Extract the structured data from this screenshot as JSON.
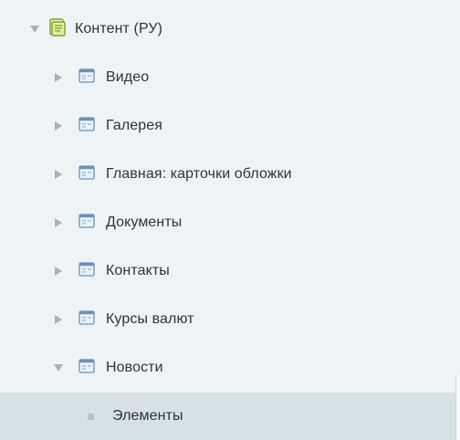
{
  "tree": {
    "root": {
      "label": "Контент (РУ)",
      "expanded": true,
      "icon": "iblock-type-icon"
    },
    "children": [
      {
        "label": "Видео",
        "expanded": false,
        "icon": "iblock-icon"
      },
      {
        "label": "Галерея",
        "expanded": false,
        "icon": "iblock-icon"
      },
      {
        "label": "Главная: карточки обложки",
        "expanded": false,
        "icon": "iblock-icon"
      },
      {
        "label": "Документы",
        "expanded": false,
        "icon": "iblock-icon"
      },
      {
        "label": "Контакты",
        "expanded": false,
        "icon": "iblock-icon"
      },
      {
        "label": "Курсы валют",
        "expanded": false,
        "icon": "iblock-icon"
      },
      {
        "label": "Новости",
        "expanded": true,
        "icon": "iblock-icon"
      }
    ],
    "selected_leaf": {
      "label": "Элементы",
      "icon": "bullet-icon"
    }
  },
  "colors": {
    "background": "#eef3f5",
    "selected_row": "#d6e1e6",
    "text": "#2f3436",
    "arrow": "#a8b1b5"
  }
}
